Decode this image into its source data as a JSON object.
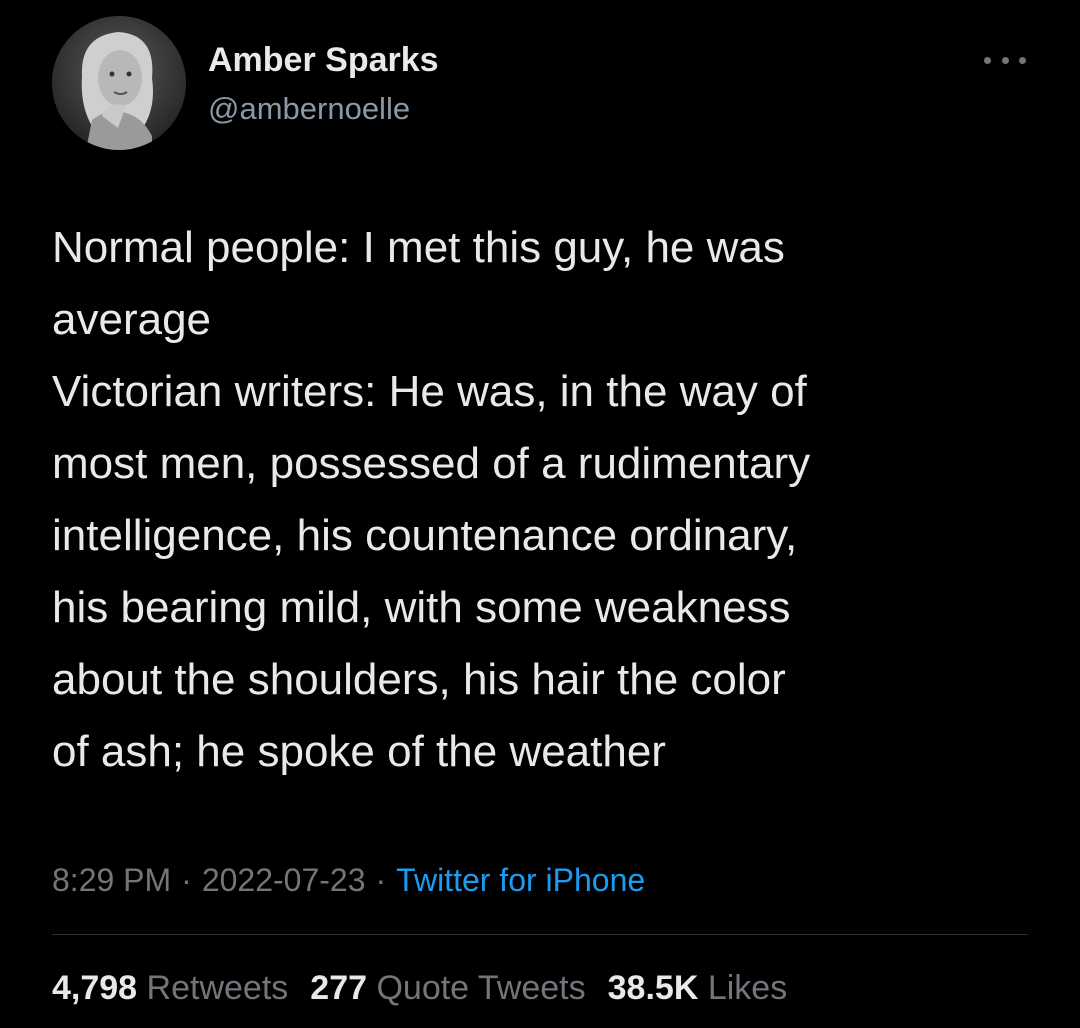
{
  "author": {
    "name": "Amber Sparks",
    "handle": "@ambernoelle"
  },
  "tweet": {
    "lines": [
      "Normal people: I met this guy, he was",
      "average",
      "Victorian writers: He was, in the way of",
      "most men, possessed of a rudimentary",
      "intelligence, his countenance ordinary,",
      "his bearing mild, with some weakness",
      "about the shoulders, his hair the color",
      "of ash; he spoke of the weather"
    ]
  },
  "meta": {
    "time": "8:29 PM",
    "separator": "·",
    "date": "2022-07-23",
    "source": "Twitter for iPhone"
  },
  "stats": {
    "retweets_count": "4,798",
    "retweets_label": "Retweets",
    "quotes_count": "277",
    "quotes_label": "Quote Tweets",
    "likes_count": "38.5K",
    "likes_label": "Likes"
  },
  "icons": {
    "more": "more-options-icon"
  },
  "colors": {
    "background": "#000000",
    "text": "#e7e9ea",
    "secondary": "#71767b",
    "link": "#1d9bf0",
    "divider": "#2f3336"
  }
}
